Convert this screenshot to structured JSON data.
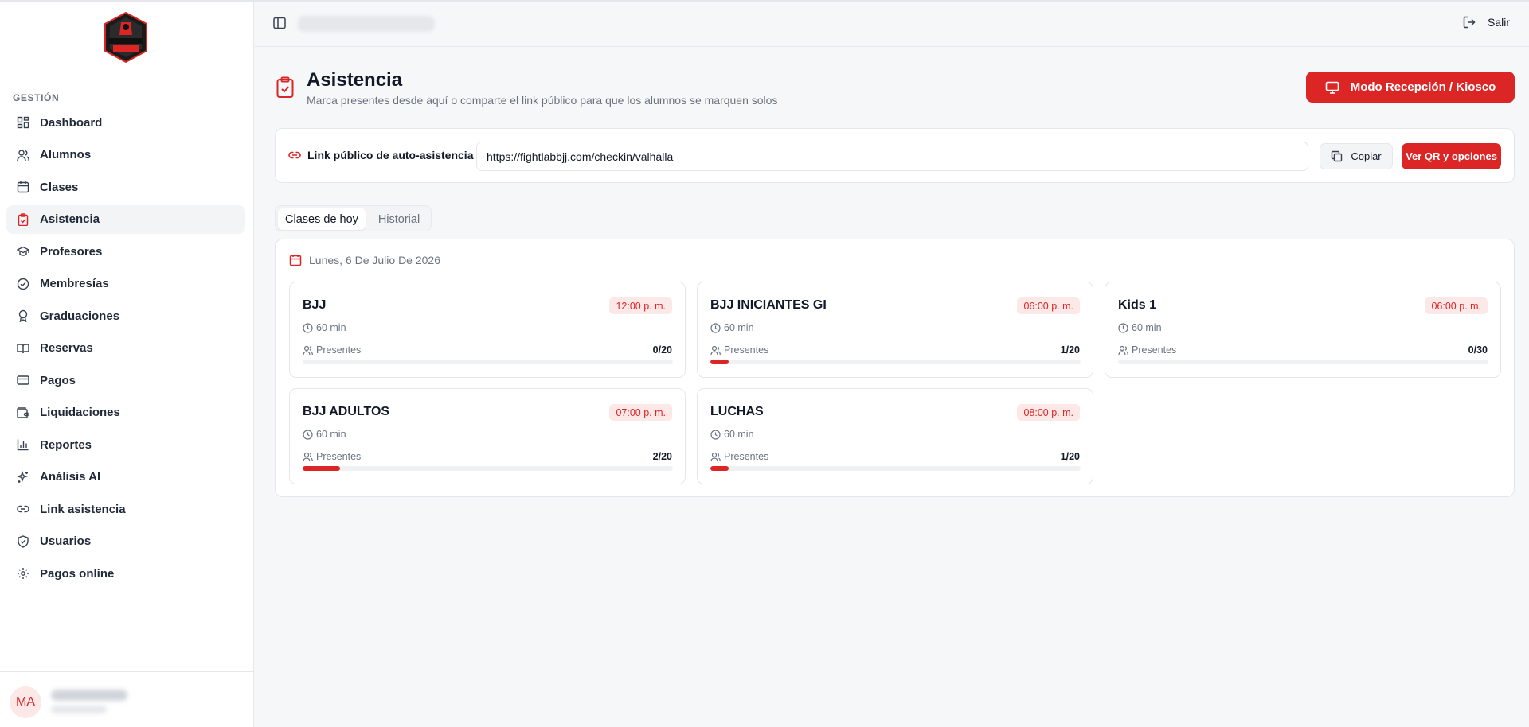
{
  "colors": {
    "accent": "#dc2626",
    "accent_soft": "#fde8e8"
  },
  "logo": {
    "name": "fight-lab-bjj-logo",
    "text_top": "FIGHT LAB",
    "text_bottom": "BJJ"
  },
  "sidebar": {
    "section_label": "GESTIÓN",
    "items": [
      {
        "label": "Dashboard",
        "icon": "dashboard-icon"
      },
      {
        "label": "Alumnos",
        "icon": "users-icon"
      },
      {
        "label": "Clases",
        "icon": "calendar-icon"
      },
      {
        "label": "Asistencia",
        "icon": "clipboard-check-icon",
        "active": true
      },
      {
        "label": "Profesores",
        "icon": "graduation-cap-icon"
      },
      {
        "label": "Membresías",
        "icon": "check-circle-icon"
      },
      {
        "label": "Graduaciones",
        "icon": "award-icon"
      },
      {
        "label": "Reservas",
        "icon": "book-open-icon"
      },
      {
        "label": "Pagos",
        "icon": "credit-card-icon"
      },
      {
        "label": "Liquidaciones",
        "icon": "wallet-icon"
      },
      {
        "label": "Reportes",
        "icon": "bar-chart-icon"
      },
      {
        "label": "Análisis AI",
        "icon": "sparkles-icon"
      },
      {
        "label": "Link asistencia",
        "icon": "link-icon"
      },
      {
        "label": "Usuarios",
        "icon": "shield-icon"
      },
      {
        "label": "Pagos online",
        "icon": "gear-icon"
      }
    ],
    "user": {
      "initials": "MA"
    }
  },
  "topbar": {
    "logout_label": "Salir"
  },
  "page": {
    "title": "Asistencia",
    "subtitle": "Marca presentes desde aquí o comparte el link público para que los alumnos se marquen solos",
    "kiosk_button": "Modo Recepción / Kiosco"
  },
  "link_card": {
    "label": "Link público de auto-asistencia",
    "url": "https://fightlabbjj.com/checkin/valhalla",
    "copy_button": "Copiar",
    "qr_button": "Ver QR y opciones"
  },
  "tabs": [
    {
      "label": "Clases de hoy",
      "active": true
    },
    {
      "label": "Historial",
      "active": false
    }
  ],
  "schedule": {
    "date_label": "Lunes, 6 De Julio De 2026",
    "present_label": "Presentes",
    "classes": [
      {
        "name": "BJJ",
        "time": "12:00 p. m.",
        "duration": "60 min",
        "count": "0/20",
        "fill": 0.0
      },
      {
        "name": "BJJ INICIANTES GI",
        "time": "06:00 p. m.",
        "duration": "60 min",
        "count": "1/20",
        "fill": 0.05
      },
      {
        "name": "Kids 1",
        "time": "06:00 p. m.",
        "duration": "60 min",
        "count": "0/30",
        "fill": 0.0
      },
      {
        "name": "BJJ ADULTOS",
        "time": "07:00 p. m.",
        "duration": "60 min",
        "count": "2/20",
        "fill": 0.1
      },
      {
        "name": "LUCHAS",
        "time": "08:00 p. m.",
        "duration": "60 min",
        "count": "1/20",
        "fill": 0.05
      }
    ]
  }
}
